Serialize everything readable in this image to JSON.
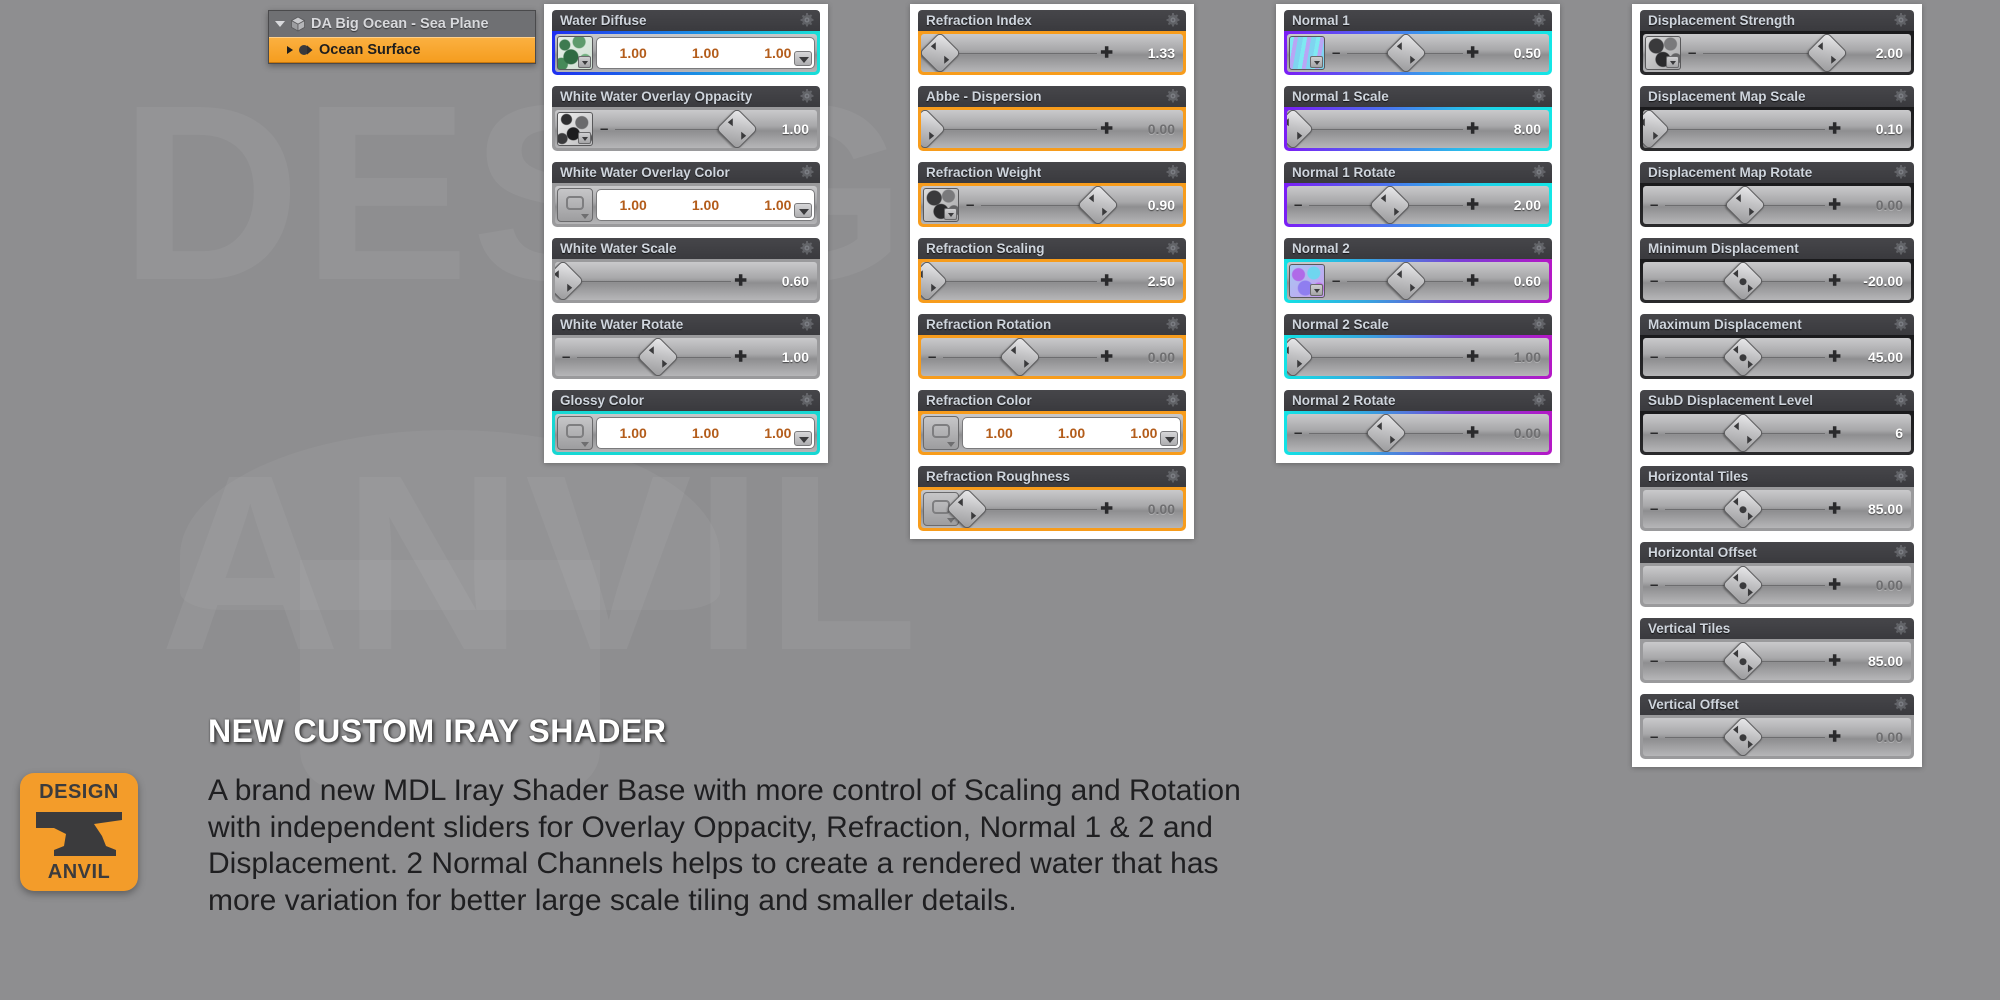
{
  "scene_tree": {
    "root": {
      "label": "DA Big Ocean - Sea Plane",
      "icon": "cube-icon",
      "expander": "triangle-down-icon"
    },
    "child": {
      "label": "Ocean Surface",
      "icon": "material-icon",
      "expander": "triangle-right-icon",
      "selected": true
    }
  },
  "banner": {
    "logo_top": "DESIGN",
    "logo_bottom": "ANVIL",
    "headline": "NEW CUSTOM IRAY SHADER",
    "body": "A brand new MDL Iray Shader Base with more control of Scaling and Rotation with independent sliders for Overlay Oppacity, Refraction, Normal 1 & 2 and Displacement. 2 Normal Channels helps to create a rendered water that has more variation for better large scale tiling and smaller details."
  },
  "watermark": {
    "line1": "DESIGN",
    "line2": "ANVIL"
  },
  "colors": {
    "orange_accent": "#f79c1c",
    "selection_orange": "#f59d1f",
    "normal1_gradient_start": "#7b1df5",
    "normal1_gradient_end": "#13e6e6",
    "normal2_gradient_start": "#12e3e5",
    "normal2_gradient_end": "#b517c6",
    "diffuse_border": "#1f2ff0",
    "glossy_border": "#17d7d3",
    "displacement_border": "#1a1a1c",
    "header_bg": "#3f3f43",
    "header_text": "#cfd5dd",
    "page_bg": "#8e8e90",
    "rgb_value_text": "#b35c1a"
  },
  "columns": [
    {
      "id": "column-1",
      "props": [
        {
          "label": "Water Diffuse",
          "type": "rgb",
          "accent": "blue",
          "thumb": "water-texture-thumbnail",
          "thumb_style": "tx-water",
          "rgb": [
            "1.00",
            "1.00",
            "1.00"
          ]
        },
        {
          "label": "White Water Overlay Oppacity",
          "type": "slider",
          "accent": "none",
          "thumb": "foam-texture-thumbnail",
          "thumb_style": "tx-foam",
          "value": "1.00",
          "knob_pct": 86,
          "minus": true,
          "plus": false,
          "dim": false
        },
        {
          "label": "White Water Overlay Color",
          "type": "rgb",
          "accent": "none",
          "color_button": true,
          "rgb": [
            "1.00",
            "1.00",
            "1.00"
          ]
        },
        {
          "label": "White Water Scale",
          "type": "slider",
          "accent": "none",
          "value": "0.60",
          "knob_pct": 4,
          "minus": false,
          "plus": true,
          "dim": false
        },
        {
          "label": "White Water Rotate",
          "type": "slider",
          "accent": "none",
          "value": "1.00",
          "knob_pct": 50,
          "minus": true,
          "plus": true,
          "dim": false
        },
        {
          "label": "Glossy Color",
          "type": "rgb",
          "accent": "cyan",
          "color_button": true,
          "rgb": [
            "1.00",
            "1.00",
            "1.00"
          ]
        }
      ]
    },
    {
      "id": "column-2",
      "props": [
        {
          "label": "Refraction Index",
          "type": "slider",
          "accent": "orange",
          "value": "1.33",
          "knob_pct": 9,
          "minus": true,
          "plus": true,
          "dim": false
        },
        {
          "label": "Abbe - Dispersion",
          "type": "slider",
          "accent": "orange",
          "value": "0.00",
          "knob_pct": 2,
          "minus": false,
          "plus": true,
          "dim": true
        },
        {
          "label": "Refraction Weight",
          "type": "slider",
          "accent": "orange",
          "thumb": "rock-texture-thumbnail",
          "thumb_style": "tx-rock",
          "value": "0.90",
          "knob_pct": 83,
          "minus": true,
          "plus": true,
          "dim": false
        },
        {
          "label": "Refraction Scaling",
          "type": "slider",
          "accent": "orange",
          "value": "2.50",
          "knob_pct": 3,
          "minus": false,
          "plus": true,
          "dim": false
        },
        {
          "label": "Refraction Rotation",
          "type": "slider",
          "accent": "orange",
          "value": "0.00",
          "knob_pct": 48,
          "minus": true,
          "plus": true,
          "dim": true
        },
        {
          "label": "Refraction Color",
          "type": "rgb",
          "accent": "orange",
          "color_button": true,
          "rgb": [
            "1.00",
            "1.00",
            "1.00"
          ]
        },
        {
          "label": "Refraction Roughness",
          "type": "slider",
          "accent": "orange",
          "color_button": true,
          "value": "0.00",
          "knob_pct": 5,
          "minus": false,
          "plus": true,
          "dim": true
        }
      ]
    },
    {
      "id": "column-3",
      "props": [
        {
          "label": "Normal 1",
          "type": "slider",
          "accent": "np",
          "thumb": "normal-map-1-thumbnail",
          "thumb_style": "tx-norm1",
          "value": "0.50",
          "knob_pct": 48,
          "minus": true,
          "plus": true,
          "dim": false
        },
        {
          "label": "Normal 1 Scale",
          "type": "slider",
          "accent": "np",
          "value": "8.00",
          "knob_pct": 3,
          "minus": true,
          "plus": true,
          "dim": false
        },
        {
          "label": "Normal 1 Rotate",
          "type": "slider",
          "accent": "np",
          "value": "2.00",
          "knob_pct": 50,
          "minus": true,
          "plus": true,
          "dim": false
        },
        {
          "label": "Normal 2",
          "type": "slider",
          "accent": "pn",
          "thumb": "normal-map-2-thumbnail",
          "thumb_style": "tx-norm2",
          "value": "0.60",
          "knob_pct": 48,
          "minus": true,
          "plus": true,
          "dim": false
        },
        {
          "label": "Normal 2 Scale",
          "type": "slider",
          "accent": "pn",
          "value": "1.00",
          "knob_pct": 3,
          "minus": true,
          "plus": true,
          "dim": true
        },
        {
          "label": "Normal 2 Rotate",
          "type": "slider",
          "accent": "pn",
          "value": "0.00",
          "knob_pct": 48,
          "minus": true,
          "plus": true,
          "dim": true
        }
      ]
    },
    {
      "id": "column-4",
      "props": [
        {
          "label": "Displacement Strength",
          "type": "slider",
          "accent": "dark",
          "thumb": "displacement-map-thumbnail",
          "thumb_style": "tx-rock",
          "value": "2.00",
          "knob_pct": 84,
          "minus": true,
          "plus": false,
          "dim": false
        },
        {
          "label": "Displacement Map Scale",
          "type": "slider",
          "accent": "dark",
          "value": "0.10",
          "knob_pct": 3,
          "minus": false,
          "plus": true,
          "dim": false
        },
        {
          "label": "Displacement Map Rotate",
          "type": "slider",
          "accent": "dark",
          "value": "0.00",
          "knob_pct": 48,
          "minus": true,
          "plus": true,
          "dim": true
        },
        {
          "label": "Minimum Displacement",
          "type": "slider",
          "accent": "dark",
          "value": "-20.00",
          "knob_pct": 47,
          "minus": true,
          "plus": true,
          "dim": false,
          "dotknob": true
        },
        {
          "label": "Maximum Displacement",
          "type": "slider",
          "accent": "dark",
          "value": "45.00",
          "knob_pct": 47,
          "minus": true,
          "plus": true,
          "dim": false,
          "dotknob": true
        },
        {
          "label": "SubD Displacement Level",
          "type": "slider",
          "accent": "dark",
          "value": "6",
          "knob_pct": 47,
          "minus": true,
          "plus": true,
          "dim": false
        },
        {
          "label": "Horizontal Tiles",
          "type": "slider",
          "accent": "none",
          "value": "85.00",
          "knob_pct": 47,
          "minus": true,
          "plus": true,
          "dim": false,
          "dotknob": true
        },
        {
          "label": "Horizontal Offset",
          "type": "slider",
          "accent": "none",
          "value": "0.00",
          "knob_pct": 47,
          "minus": true,
          "plus": true,
          "dim": true,
          "dotknob": true
        },
        {
          "label": "Vertical Tiles",
          "type": "slider",
          "accent": "none",
          "value": "85.00",
          "knob_pct": 47,
          "minus": true,
          "plus": true,
          "dim": false,
          "dotknob": true
        },
        {
          "label": "Vertical Offset",
          "type": "slider",
          "accent": "none",
          "value": "0.00",
          "knob_pct": 47,
          "minus": true,
          "plus": true,
          "dim": true,
          "dotknob": true
        }
      ]
    }
  ]
}
